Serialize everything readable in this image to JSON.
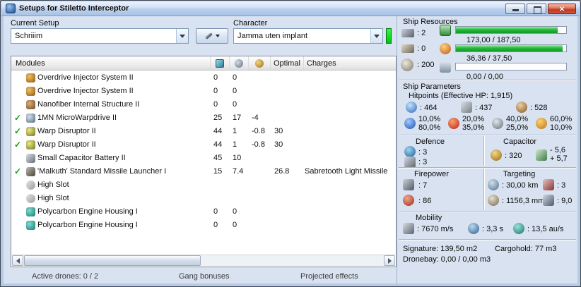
{
  "window": {
    "title": "Setups for Stiletto Interceptor"
  },
  "toolbar": {
    "current_setup_label": "Current Setup",
    "current_setup_value": "Schriiim",
    "character_label": "Character",
    "character_value": "Jamma uten implant"
  },
  "modules_table": {
    "headers": {
      "modules": "Modules",
      "optimal": "Optimal",
      "charges": "Charges"
    },
    "header_icons": [
      "cpu-icon",
      "powergrid-icon",
      "capacitor-icon"
    ],
    "rows": [
      {
        "check": "",
        "icon": "overdrive",
        "name": "Overdrive Injector System II",
        "cpu": "0",
        "pg": "0",
        "cap": "",
        "optimal": "",
        "charges": ""
      },
      {
        "check": "",
        "icon": "overdrive",
        "name": "Overdrive Injector System II",
        "cpu": "0",
        "pg": "0",
        "cap": "",
        "optimal": "",
        "charges": ""
      },
      {
        "check": "",
        "icon": "nanofiber",
        "name": "Nanofiber Internal Structure II",
        "cpu": "0",
        "pg": "0",
        "cap": "",
        "optimal": "",
        "charges": ""
      },
      {
        "check": "✓",
        "icon": "mwd",
        "name": "1MN MicroWarpdrive II",
        "cpu": "25",
        "pg": "17",
        "cap": "-4",
        "optimal": "",
        "charges": ""
      },
      {
        "check": "✓",
        "icon": "disruptor",
        "name": "Warp Disruptor II",
        "cpu": "44",
        "pg": "1",
        "cap": "-0.8",
        "optimal": "30",
        "charges": ""
      },
      {
        "check": "✓",
        "icon": "disruptor",
        "name": "Warp Disruptor II",
        "cpu": "44",
        "pg": "1",
        "cap": "-0.8",
        "optimal": "30",
        "charges": ""
      },
      {
        "check": "",
        "icon": "battery",
        "name": "Small Capacitor Battery II",
        "cpu": "45",
        "pg": "10",
        "cap": "",
        "optimal": "",
        "charges": ""
      },
      {
        "check": "✓",
        "icon": "launcher",
        "name": "'Malkuth' Standard Missile Launcher I",
        "cpu": "15",
        "pg": "7.4",
        "cap": "",
        "optimal": "26.8",
        "charges": "Sabretooth Light Missile"
      },
      {
        "check": "",
        "icon": "highslot",
        "name": "High Slot",
        "cpu": "",
        "pg": "",
        "cap": "",
        "optimal": "",
        "charges": ""
      },
      {
        "check": "",
        "icon": "highslot",
        "name": "High Slot",
        "cpu": "",
        "pg": "",
        "cap": "",
        "optimal": "",
        "charges": ""
      },
      {
        "check": "",
        "icon": "rig",
        "name": "Polycarbon Engine Housing I",
        "cpu": "0",
        "pg": "0",
        "cap": "",
        "optimal": "",
        "charges": ""
      },
      {
        "check": "",
        "icon": "rig",
        "name": "Polycarbon Engine Housing I",
        "cpu": "0",
        "pg": "0",
        "cap": "",
        "optimal": "",
        "charges": ""
      }
    ]
  },
  "status_bar": {
    "active_drones": "Active drones: 0 / 2",
    "gang_bonuses": "Gang bonuses",
    "projected_effects": "Projected effects"
  },
  "ship_resources": {
    "title": "Ship Resources",
    "turret_hardpoints": ": 2",
    "launcher_hardpoints": ": 0",
    "calibration": ": 200",
    "cpu_text": "173,00 / 187,50",
    "cpu_pct": 92,
    "powergrid_text": "36,36 / 37,50",
    "powergrid_pct": 97,
    "drone_text": "0,00 / 0,00",
    "drone_pct": 0
  },
  "ship_parameters": {
    "title": "Ship Parameters",
    "hitpoints_title": "Hitpoints (Effective HP: 1,915)",
    "shield_hp": ": 464",
    "armor_hp": ": 437",
    "hull_hp": ": 528",
    "resists": {
      "em_shield": "10,0%",
      "em_armor": "80,0%",
      "thermal_shield": "20,0%",
      "thermal_armor": "35,0%",
      "kinetic_shield": "40,0%",
      "kinetic_armor": "25,0%",
      "explosive_shield": "60,0%",
      "explosive_armor": "10,0%"
    }
  },
  "defence": {
    "title": "Defence",
    "row1": ": 3",
    "row2": ": 3"
  },
  "capacitor": {
    "title": "Capacitor",
    "amount": ": 320",
    "drain": "- 5,6",
    "recharge": "+ 5,7"
  },
  "firepower": {
    "title": "Firepower",
    "volley": ": 7",
    "dps": ": 86"
  },
  "targeting": {
    "title": "Targeting",
    "range": ": 30,00 km",
    "max_targets": ": 3",
    "scan_res": ": 1156,3 mm",
    "sensor_strength": ": 9,0"
  },
  "mobility": {
    "title": "Mobility",
    "speed": ": 7670 m/s",
    "align": ": 3,3 s",
    "warp": ": 13,5 au/s"
  },
  "footer": {
    "signature": "Signature: 139,50 m2",
    "cargohold": "Cargohold: 77 m3",
    "dronebay": "Dronebay: 0,00 / 0,00 m3"
  }
}
